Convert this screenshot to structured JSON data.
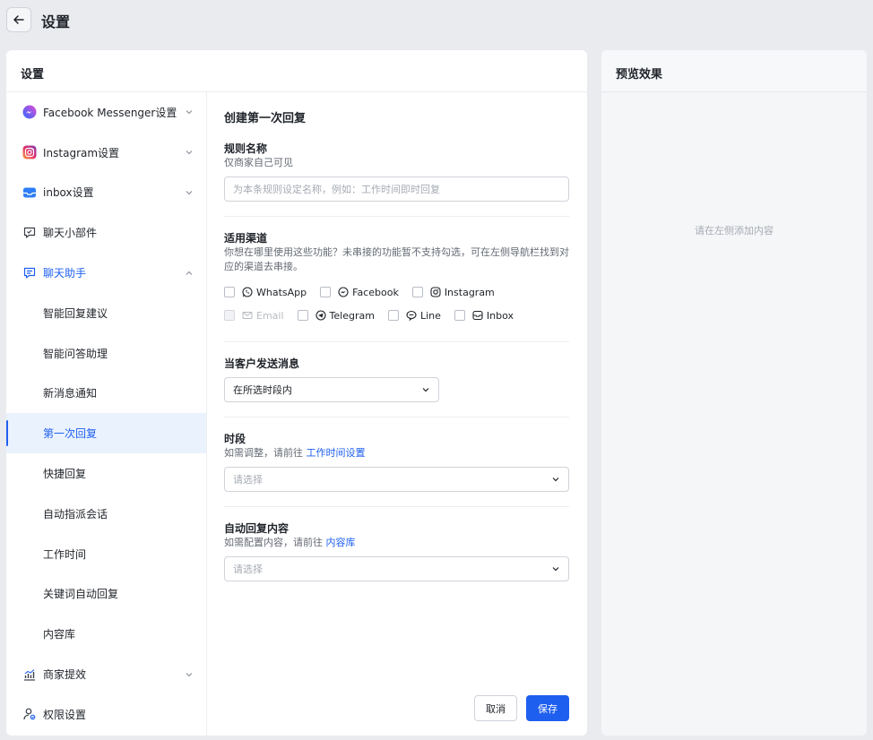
{
  "header": {
    "title": "设置"
  },
  "settings_card": {
    "title": "设置"
  },
  "sidebar": {
    "items": [
      {
        "label": "Facebook Messenger设置",
        "icon": "messenger-icon",
        "chevron": "down"
      },
      {
        "label": "Instagram设置",
        "icon": "instagram-icon",
        "chevron": "down"
      },
      {
        "label": "inbox设置",
        "icon": "inbox-icon",
        "chevron": "down"
      },
      {
        "label": "聊天小部件",
        "icon": "chat-widget-icon"
      },
      {
        "label": "聊天助手",
        "icon": "chat-assistant-icon",
        "chevron": "up",
        "expanded": true
      },
      {
        "label": "智能回复建议",
        "sub": true
      },
      {
        "label": "智能问答助理",
        "sub": true
      },
      {
        "label": "新消息通知",
        "sub": true
      },
      {
        "label": "第一次回复",
        "sub": true,
        "active": true
      },
      {
        "label": "快捷回复",
        "sub": true
      },
      {
        "label": "自动指派会话",
        "sub": true
      },
      {
        "label": "工作时间",
        "sub": true
      },
      {
        "label": "关键词自动回复",
        "sub": true
      },
      {
        "label": "内容库",
        "sub": true
      },
      {
        "label": "商家提效",
        "icon": "chart-icon",
        "chevron": "down"
      },
      {
        "label": "权限设置",
        "icon": "user-permission-icon"
      }
    ]
  },
  "form": {
    "title": "创建第一次回复",
    "rule_name": {
      "label": "规则名称",
      "hint": "仅商家自己可见",
      "placeholder": "为本条规则设定名称，例如：工作时间即时回复"
    },
    "channels": {
      "label": "适用渠道",
      "hint": "你想在哪里使用这些功能？未串接的功能暂不支持勾选，可在左侧导航栏找到对应的渠道去串接。",
      "options": [
        {
          "label": "WhatsApp",
          "icon": "whatsapp-icon",
          "checked": false,
          "disabled": false
        },
        {
          "label": "Facebook",
          "icon": "messenger-icon",
          "checked": false,
          "disabled": false
        },
        {
          "label": "Instagram",
          "icon": "instagram-icon",
          "checked": false,
          "disabled": false
        },
        {
          "label": "Email",
          "icon": "email-icon",
          "checked": false,
          "disabled": true
        },
        {
          "label": "Telegram",
          "icon": "telegram-icon",
          "checked": false,
          "disabled": false
        },
        {
          "label": "Line",
          "icon": "line-icon",
          "checked": false,
          "disabled": false
        },
        {
          "label": "Inbox",
          "icon": "inbox-icon",
          "checked": false,
          "disabled": false
        }
      ]
    },
    "trigger": {
      "label": "当客户发送消息",
      "value": "在所选时段内"
    },
    "period": {
      "label": "时段",
      "hint_prefix": "如需调整，请前往",
      "hint_link": "工作时间设置",
      "placeholder": "请选择"
    },
    "auto_reply": {
      "label": "自动回复内容",
      "hint_prefix": "如需配置内容，请前往",
      "hint_link": "内容库",
      "placeholder": "请选择"
    },
    "cancel_label": "取消",
    "save_label": "保存"
  },
  "preview": {
    "title": "预览效果",
    "empty_text": "请在左侧添加内容"
  },
  "colors": {
    "accent": "#1e5ff0",
    "page_bg": "#e9ebef"
  }
}
